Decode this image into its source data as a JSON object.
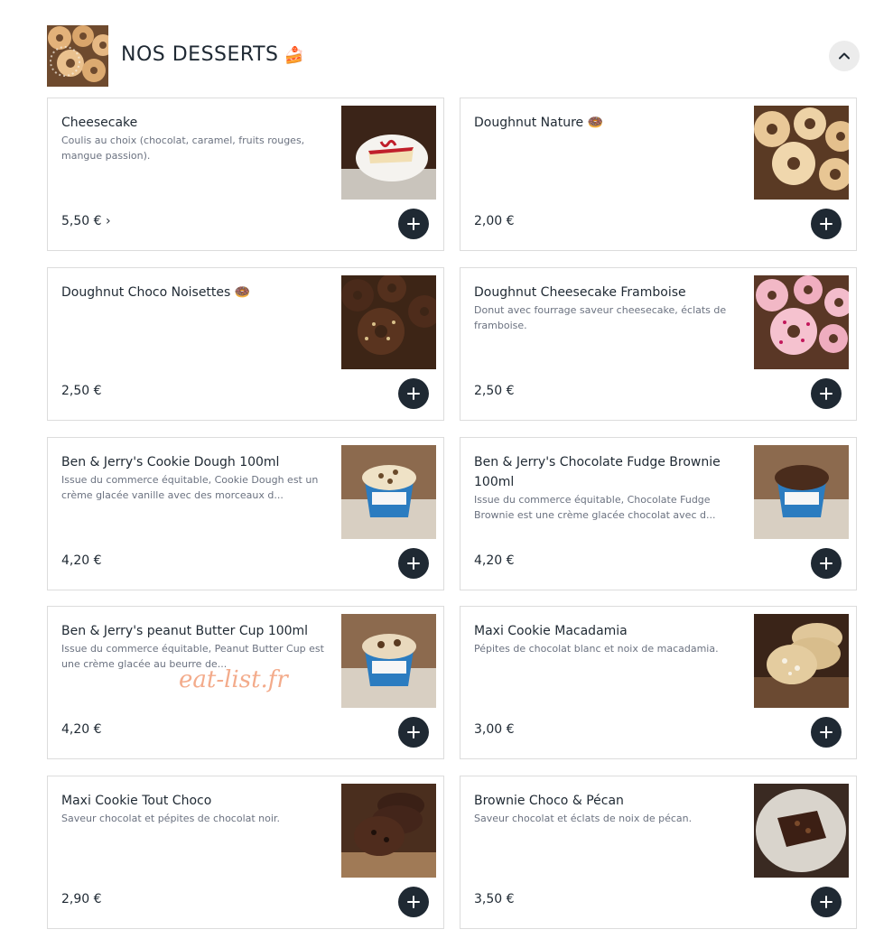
{
  "section": {
    "title": "NOS DESSERTS",
    "title_icon": "cake-icon",
    "collapse_icon": "chevron-up-icon"
  },
  "items": [
    {
      "name": "Cheesecake",
      "desc": "Coulis au choix (chocolat, caramel, fruits rouges, mangue passion).",
      "price": "5,50 € ›",
      "photo": "cheesecake"
    },
    {
      "name": "Doughnut Nature 🍩",
      "desc": "",
      "price": "2,00 €",
      "photo": "doughnut-nature"
    },
    {
      "name": "Doughnut Choco Noisettes 🍩",
      "desc": "",
      "price": "2,50 €",
      "photo": "doughnut-choco"
    },
    {
      "name": "Doughnut Cheesecake Framboise",
      "desc": "Donut avec fourrage saveur cheesecake, éclats de framboise.",
      "price": "2,50 €",
      "photo": "doughnut-framboise"
    },
    {
      "name": "Ben & Jerry's Cookie Dough 100ml",
      "desc": "Issue du commerce équitable, Cookie Dough est un crème glacée vanille avec des morceaux d...",
      "price": "4,20 €",
      "photo": "icecream-vanilla"
    },
    {
      "name": "Ben & Jerry's Chocolate Fudge Brownie 100ml",
      "desc": "Issue du commerce équitable, Chocolate Fudge Brownie est une crème glacée chocolat avec d...",
      "price": "4,20 €",
      "photo": "icecream-chocolate"
    },
    {
      "name": "Ben & Jerry's peanut Butter Cup 100ml",
      "desc": "Issue du commerce équitable, Peanut Butter Cup est une crème glacée au beurre de...",
      "price": "4,20 €",
      "photo": "icecream-peanut"
    },
    {
      "name": "Maxi Cookie Macadamia",
      "desc": "Pépites de chocolat blanc et noix de macadamia.",
      "price": "3,00 €",
      "photo": "cookie-macadamia"
    },
    {
      "name": "Maxi Cookie Tout Choco",
      "desc": "Saveur chocolat et pépites de chocolat noir.",
      "price": "2,90 €",
      "photo": "cookie-choco"
    },
    {
      "name": "Brownie Choco & Pécan",
      "desc": "Saveur chocolat et éclats de noix de pécan.",
      "price": "3,50 €",
      "photo": "brownie"
    }
  ],
  "add_icon": "plus-icon",
  "watermark": "eat-list.fr"
}
